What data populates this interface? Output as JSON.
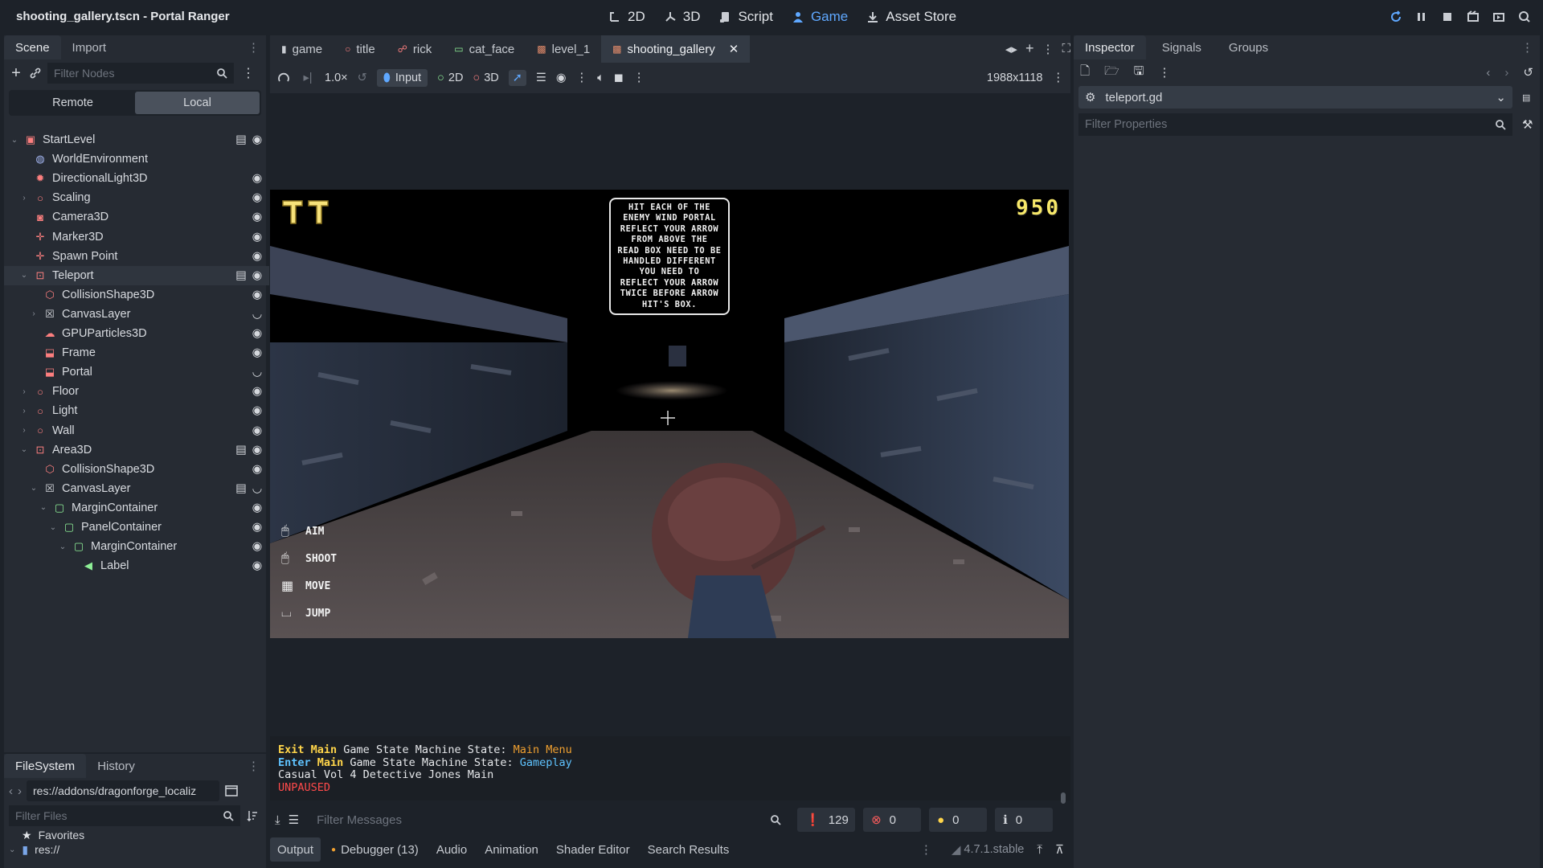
{
  "window": {
    "title": "shooting_gallery.tscn - Portal Ranger"
  },
  "main_screens": [
    {
      "label": "2D",
      "icon": "2d-icon"
    },
    {
      "label": "3D",
      "icon": "3d-icon"
    },
    {
      "label": "Script",
      "icon": "script-icon"
    },
    {
      "label": "Game",
      "icon": "game-icon"
    },
    {
      "label": "Asset Store",
      "icon": "download-icon"
    }
  ],
  "colors": {
    "accent": "#4a9eff",
    "node_red": "#fc7f7f",
    "node_green": "#8eef97",
    "node_purple": "#a5b7f3",
    "log_yellow": "#ffd54a",
    "log_orange": "#f0a030",
    "log_cyan": "#5fc3ff",
    "log_red": "#ff4a4a"
  },
  "left_dock": {
    "tabs": [
      "Scene",
      "Import"
    ],
    "filter_placeholder": "Filter Nodes",
    "remote_label": "Remote",
    "local_label": "Local",
    "tree": [
      {
        "label": "StartLevel",
        "icon": "root-node-icon",
        "depth": 0,
        "expanded": true,
        "script": true,
        "visible": true
      },
      {
        "label": "WorldEnvironment",
        "icon": "world-env-icon",
        "depth": 1
      },
      {
        "label": "DirectionalLight3D",
        "icon": "light-icon",
        "depth": 1,
        "visible": true
      },
      {
        "label": "Scaling",
        "icon": "node3d-icon",
        "depth": 1,
        "collapsed": true,
        "visible": true
      },
      {
        "label": "Camera3D",
        "icon": "camera-icon",
        "depth": 1,
        "visible": true
      },
      {
        "label": "Marker3D",
        "icon": "marker-icon",
        "depth": 1,
        "visible": true
      },
      {
        "label": "Spawn Point",
        "icon": "marker-icon",
        "depth": 1,
        "visible": true
      },
      {
        "label": "Teleport",
        "icon": "area-icon",
        "depth": 1,
        "expanded": true,
        "script": true,
        "visible": true,
        "selected": true
      },
      {
        "label": "CollisionShape3D",
        "icon": "collision-icon",
        "depth": 2,
        "visible": true
      },
      {
        "label": "CanvasLayer",
        "icon": "canvas-layer-icon",
        "depth": 2,
        "collapsed": true,
        "hidden": true
      },
      {
        "label": "GPUParticles3D",
        "icon": "particles-icon",
        "depth": 2,
        "visible": true
      },
      {
        "label": "Frame",
        "icon": "mesh-icon",
        "depth": 2,
        "visible": true
      },
      {
        "label": "Portal",
        "icon": "mesh-icon",
        "depth": 2,
        "hidden": true
      },
      {
        "label": "Floor",
        "icon": "node3d-icon",
        "depth": 1,
        "collapsed": true,
        "visible": true
      },
      {
        "label": "Light",
        "icon": "node3d-icon",
        "depth": 1,
        "collapsed": true,
        "visible": true
      },
      {
        "label": "Wall",
        "icon": "node3d-icon",
        "depth": 1,
        "collapsed": true,
        "visible": true
      },
      {
        "label": "Area3D",
        "icon": "area-icon",
        "depth": 1,
        "expanded": true,
        "script": true,
        "visible": true
      },
      {
        "label": "CollisionShape3D",
        "icon": "collision-icon",
        "depth": 2,
        "visible": true
      },
      {
        "label": "CanvasLayer",
        "icon": "canvas-layer-icon",
        "depth": 2,
        "expanded": true,
        "script": true,
        "hidden": true
      },
      {
        "label": "MarginContainer",
        "icon": "container-icon",
        "depth": 3,
        "expanded": true,
        "visible": true
      },
      {
        "label": "PanelContainer",
        "icon": "container-icon",
        "depth": 4,
        "expanded": true,
        "visible": true
      },
      {
        "label": "MarginContainer",
        "icon": "container-icon",
        "depth": 5,
        "expanded": true,
        "visible": true
      },
      {
        "label": "Label",
        "icon": "label-icon",
        "depth": 6,
        "visible": true
      }
    ]
  },
  "filesystem": {
    "tabs": [
      "FileSystem",
      "History"
    ],
    "path": "res://addons/dragonforge_localiz",
    "filter_placeholder": "Filter Files",
    "items": [
      {
        "label": "Favorites",
        "icon": "star-icon"
      },
      {
        "label": "res://",
        "icon": "folder-icon"
      }
    ]
  },
  "editor_tabs": [
    {
      "label": "game",
      "icon": "script-icon"
    },
    {
      "label": "title",
      "icon": "node3d-icon"
    },
    {
      "label": "rick",
      "icon": "skeleton-icon"
    },
    {
      "label": "cat_face",
      "icon": "control-icon"
    },
    {
      "label": "level_1",
      "icon": "scene-icon"
    },
    {
      "label": "shooting_gallery",
      "icon": "scene-icon",
      "selected": true
    }
  ],
  "game_toolbar": {
    "speed": "1.0×",
    "input_label": "Input",
    "label_2d": "2D",
    "label_3d": "3D",
    "resolution": "1988x1118"
  },
  "game": {
    "sign_lines": [
      "HIT EACH OF THE",
      "ENEMY WIND PORTAL",
      "REFLECT YOUR ARROW",
      "FROM ABOVE THE",
      "READ BOX NEED TO BE",
      "HANDLED DIFFERENT",
      "YOU NEED TO",
      "REFLECT YOUR ARROW",
      "TWICE BEFORE ARROW",
      "HIT'S BOX."
    ],
    "score": "950",
    "controls": [
      {
        "label": "AIM",
        "icon": "mouse-right-icon"
      },
      {
        "label": "SHOOT",
        "icon": "mouse-left-icon"
      },
      {
        "label": "MOVE",
        "icon": "wasd-icon"
      },
      {
        "label": "JUMP",
        "icon": "space-key-icon"
      }
    ]
  },
  "output": {
    "lines": [
      {
        "prefix": "Exit",
        "scope": "Main",
        "text": " Game State Machine State: ",
        "state": "Main Menu",
        "state_color": "#f0a030"
      },
      {
        "prefix": "Enter",
        "scope": "Main",
        "text": " Game State Machine State: ",
        "state": "Gameplay",
        "state_color": "#5fc3ff"
      },
      {
        "text": "Casual Vol 4 Detective Jones Main"
      },
      {
        "text": "UNPAUSED",
        "color": "#ff4a4a"
      }
    ],
    "filter_placeholder": "Filter Messages",
    "counts": {
      "messages": "129",
      "errors": "0",
      "warnings": "0",
      "info": "0"
    }
  },
  "bottom_tabs": [
    "Output",
    "Debugger (13)",
    "Audio",
    "Animation",
    "Shader Editor",
    "Search Results"
  ],
  "version": "4.7.1.stable",
  "inspector": {
    "tabs": [
      "Inspector",
      "Signals",
      "Groups"
    ],
    "resource": "teleport.gd",
    "filter_placeholder": "Filter Properties"
  }
}
